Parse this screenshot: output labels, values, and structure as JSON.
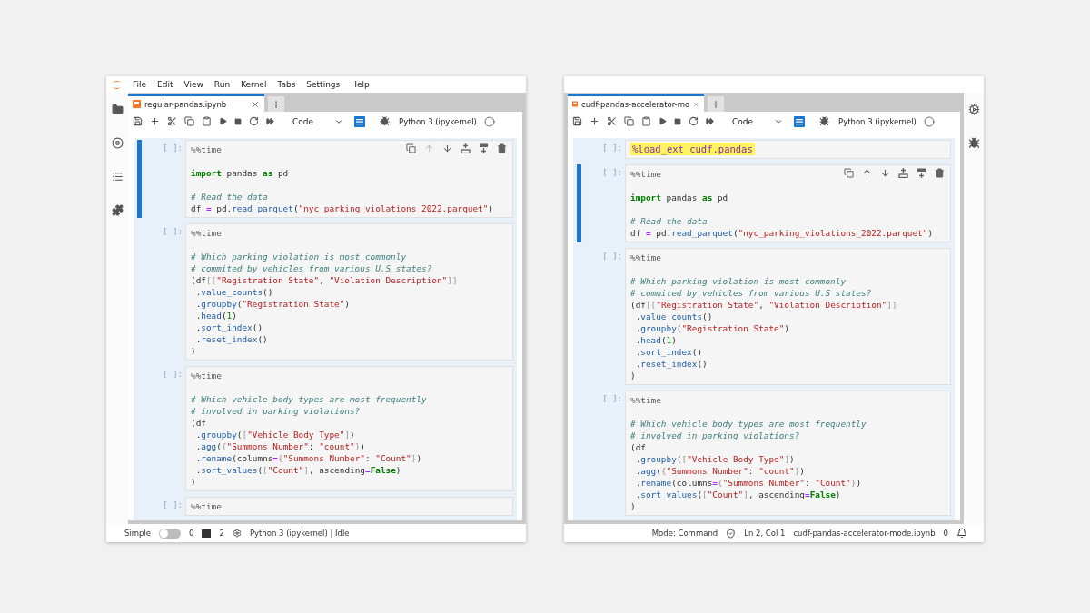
{
  "windows": [
    {
      "menu": [
        "File",
        "Edit",
        "View",
        "Run",
        "Kernel",
        "Tabs",
        "Settings",
        "Help"
      ],
      "left_sidebar": [
        {
          "kind": "folder"
        },
        {
          "kind": "stop"
        },
        {
          "kind": "list"
        },
        {
          "kind": "puzzle"
        }
      ],
      "tabs": [
        {
          "label": "regular-pandas.ipynb",
          "selected": true
        }
      ],
      "new_tab": "+",
      "toolbar": [
        {
          "kind": "save"
        },
        {
          "kind": "add"
        },
        {
          "kind": "cut"
        },
        {
          "kind": "copy"
        },
        {
          "kind": "paste"
        },
        {
          "kind": "run"
        },
        {
          "kind": "stop"
        },
        {
          "kind": "restart"
        },
        {
          "kind": "run-all"
        },
        {
          "kind": "dropdown",
          "text": "Code"
        },
        {
          "kind": "inspector"
        },
        {
          "kind": "bug"
        },
        {
          "kind": "kernel",
          "text": "Python 3 (ipykernel)"
        },
        {
          "kind": "status"
        }
      ],
      "cells": [
        {
          "prompt": "[ ]:",
          "selected": true,
          "toolbar": [
            {
              "kind": "duplicate",
              "disabled": false
            },
            {
              "kind": "up",
              "disabled": true
            },
            {
              "kind": "down",
              "disabled": false
            },
            {
              "kind": "insert-above",
              "disabled": false
            },
            {
              "kind": "insert-below",
              "disabled": false
            },
            {
              "kind": "delete",
              "disabled": false
            }
          ],
          "lines": [
            {
              "tokens": [
                {
                  "kind": "mg",
                  "text": "%%time"
                }
              ]
            },
            {
              "gap": true,
              "tokens": [
                {
                  "kind": "kw",
                  "text": "import"
                },
                {
                  "kind": "p",
                  "text": " pandas "
                },
                {
                  "kind": "kw",
                  "text": "as"
                },
                {
                  "kind": "p",
                  "text": " pd"
                }
              ]
            },
            {
              "gap": true,
              "tokens": [
                {
                  "kind": "cm",
                  "text": "# Read the data"
                }
              ]
            },
            {
              "tokens": [
                {
                  "kind": "p",
                  "text": "df "
                },
                {
                  "kind": "op",
                  "text": "="
                },
                {
                  "kind": "p",
                  "text": " pd."
                },
                {
                  "kind": "fn",
                  "text": "read_parquet"
                },
                {
                  "kind": "p",
                  "text": "("
                },
                {
                  "kind": "str",
                  "text": "\"nyc_parking_violations_2022.parquet\""
                },
                {
                  "kind": "p",
                  "text": ")"
                }
              ]
            }
          ]
        },
        {
          "prompt": "[ ]:",
          "selected": false,
          "lines": [
            {
              "tokens": [
                {
                  "kind": "mg",
                  "text": "%%time"
                }
              ]
            },
            {
              "gap": true,
              "tokens": [
                {
                  "kind": "cm",
                  "text": "# Which parking violation is most commonly"
                }
              ]
            },
            {
              "tokens": [
                {
                  "kind": "cm",
                  "text": "# commited by vehicles from various U.S states?"
                }
              ]
            },
            {
              "tokens": [
                {
                  "kind": "p",
                  "text": "(df"
                },
                {
                  "kind": "br",
                  "text": "[["
                },
                {
                  "kind": "str",
                  "text": "\"Registration State\""
                },
                {
                  "kind": "p",
                  "text": ", "
                },
                {
                  "kind": "str",
                  "text": "\"Violation Description\""
                },
                {
                  "kind": "br",
                  "text": "]]"
                }
              ]
            },
            {
              "tokens": [
                {
                  "kind": "p",
                  "text": " ."
                },
                {
                  "kind": "fn",
                  "text": "value_counts"
                },
                {
                  "kind": "p",
                  "text": "()"
                }
              ]
            },
            {
              "tokens": [
                {
                  "kind": "p",
                  "text": " ."
                },
                {
                  "kind": "fn",
                  "text": "groupby"
                },
                {
                  "kind": "p",
                  "text": "("
                },
                {
                  "kind": "str",
                  "text": "\"Registration State\""
                },
                {
                  "kind": "p",
                  "text": ")"
                }
              ]
            },
            {
              "tokens": [
                {
                  "kind": "p",
                  "text": " ."
                },
                {
                  "kind": "fn",
                  "text": "head"
                },
                {
                  "kind": "p",
                  "text": "("
                },
                {
                  "kind": "num",
                  "text": "1"
                },
                {
                  "kind": "p",
                  "text": ")"
                }
              ]
            },
            {
              "tokens": [
                {
                  "kind": "p",
                  "text": " ."
                },
                {
                  "kind": "fn",
                  "text": "sort_index"
                },
                {
                  "kind": "p",
                  "text": "()"
                }
              ]
            },
            {
              "tokens": [
                {
                  "kind": "p",
                  "text": " ."
                },
                {
                  "kind": "fn",
                  "text": "reset_index"
                },
                {
                  "kind": "p",
                  "text": "()"
                }
              ]
            },
            {
              "tokens": [
                {
                  "kind": "p",
                  "text": ")"
                }
              ]
            }
          ]
        },
        {
          "prompt": "[ ]:",
          "selected": false,
          "lines": [
            {
              "tokens": [
                {
                  "kind": "mg",
                  "text": "%%time"
                }
              ]
            },
            {
              "gap": true,
              "tokens": [
                {
                  "kind": "cm",
                  "text": "# Which vehicle body types are most frequently"
                }
              ]
            },
            {
              "tokens": [
                {
                  "kind": "cm",
                  "text": "# involved in parking violations?"
                }
              ]
            },
            {
              "tokens": [
                {
                  "kind": "p",
                  "text": "(df"
                }
              ]
            },
            {
              "tokens": [
                {
                  "kind": "p",
                  "text": " ."
                },
                {
                  "kind": "fn",
                  "text": "groupby"
                },
                {
                  "kind": "p",
                  "text": "("
                },
                {
                  "kind": "br",
                  "text": "["
                },
                {
                  "kind": "str",
                  "text": "\"Vehicle Body Type\""
                },
                {
                  "kind": "br",
                  "text": "]"
                },
                {
                  "kind": "p",
                  "text": ")"
                }
              ]
            },
            {
              "tokens": [
                {
                  "kind": "p",
                  "text": " ."
                },
                {
                  "kind": "fn",
                  "text": "agg"
                },
                {
                  "kind": "p",
                  "text": "("
                },
                {
                  "kind": "br",
                  "text": "{"
                },
                {
                  "kind": "str",
                  "text": "\"Summons Number\""
                },
                {
                  "kind": "p",
                  "text": ": "
                },
                {
                  "kind": "str",
                  "text": "\"count\""
                },
                {
                  "kind": "br",
                  "text": "}"
                },
                {
                  "kind": "p",
                  "text": ")"
                }
              ]
            },
            {
              "tokens": [
                {
                  "kind": "p",
                  "text": " ."
                },
                {
                  "kind": "fn",
                  "text": "rename"
                },
                {
                  "kind": "p",
                  "text": "(columns"
                },
                {
                  "kind": "op",
                  "text": "="
                },
                {
                  "kind": "br",
                  "text": "{"
                },
                {
                  "kind": "str",
                  "text": "\"Summons Number\""
                },
                {
                  "kind": "p",
                  "text": ": "
                },
                {
                  "kind": "str",
                  "text": "\"Count\""
                },
                {
                  "kind": "br",
                  "text": "}"
                },
                {
                  "kind": "p",
                  "text": ")"
                }
              ]
            },
            {
              "tokens": [
                {
                  "kind": "p",
                  "text": " ."
                },
                {
                  "kind": "fn",
                  "text": "sort_values"
                },
                {
                  "kind": "p",
                  "text": "("
                },
                {
                  "kind": "br",
                  "text": "["
                },
                {
                  "kind": "str",
                  "text": "\"Count\""
                },
                {
                  "kind": "br",
                  "text": "]"
                },
                {
                  "kind": "p",
                  "text": ", ascending"
                },
                {
                  "kind": "op",
                  "text": "="
                },
                {
                  "kind": "kw",
                  "text": "False"
                },
                {
                  "kind": "p",
                  "text": ")"
                }
              ]
            },
            {
              "tokens": [
                {
                  "kind": "p",
                  "text": ")"
                }
              ]
            }
          ]
        },
        {
          "prompt": "[ ]:",
          "selected": false,
          "lines": [
            {
              "tokens": [
                {
                  "kind": "mg",
                  "text": "%%time"
                }
              ]
            }
          ]
        }
      ],
      "status_bar": {
        "left": [
          {
            "kind": "toggle",
            "text": "Simple",
            "on": false
          },
          {
            "kind": "text",
            "text": "0"
          },
          {
            "kind": "terminal"
          },
          {
            "kind": "text",
            "text": "2"
          },
          {
            "kind": "kernel-gear"
          },
          {
            "kind": "text",
            "text": "Python 3 (ipykernel) | Idle"
          }
        ]
      }
    },
    {
      "right_sidebar": [
        {
          "kind": "gears"
        },
        {
          "kind": "bug"
        }
      ],
      "tabs": [
        {
          "label": "cudf-pandas-accelerator-mo",
          "selected": true
        }
      ],
      "new_tab": "+",
      "toolbar": [
        {
          "kind": "save"
        },
        {
          "kind": "add"
        },
        {
          "kind": "cut"
        },
        {
          "kind": "copy"
        },
        {
          "kind": "paste"
        },
        {
          "kind": "run"
        },
        {
          "kind": "stop"
        },
        {
          "kind": "restart"
        },
        {
          "kind": "run-all"
        },
        {
          "kind": "dropdown",
          "text": "Code"
        },
        {
          "kind": "inspector"
        },
        {
          "kind": "bug"
        },
        {
          "kind": "kernel",
          "text": "Python 3 (ipykernel)"
        },
        {
          "kind": "status"
        }
      ],
      "cells": [
        {
          "prompt": "[ ]:",
          "selected": false,
          "lines": [
            {
              "tokens": [
                {
                  "kind": "hl",
                  "text": "%load_ext cudf.pandas"
                }
              ]
            }
          ]
        },
        {
          "prompt": "[ ]:",
          "selected": true,
          "toolbar": [
            {
              "kind": "duplicate",
              "disabled": false
            },
            {
              "kind": "up",
              "disabled": false
            },
            {
              "kind": "down",
              "disabled": false
            },
            {
              "kind": "insert-above",
              "disabled": false
            },
            {
              "kind": "insert-below",
              "disabled": false
            },
            {
              "kind": "delete",
              "disabled": false
            }
          ],
          "lines": [
            {
              "tokens": [
                {
                  "kind": "mg",
                  "text": "%%time"
                }
              ]
            },
            {
              "gap": true,
              "tokens": [
                {
                  "kind": "kw",
                  "text": "import"
                },
                {
                  "kind": "p",
                  "text": " pandas "
                },
                {
                  "kind": "kw",
                  "text": "as"
                },
                {
                  "kind": "p",
                  "text": " pd"
                }
              ]
            },
            {
              "gap": true,
              "tokens": [
                {
                  "kind": "cm",
                  "text": "# Read the data"
                }
              ]
            },
            {
              "tokens": [
                {
                  "kind": "p",
                  "text": "df "
                },
                {
                  "kind": "op",
                  "text": "="
                },
                {
                  "kind": "p",
                  "text": " pd."
                },
                {
                  "kind": "fn",
                  "text": "read_parquet"
                },
                {
                  "kind": "p",
                  "text": "("
                },
                {
                  "kind": "str",
                  "text": "\"nyc_parking_violations_2022.parquet\""
                },
                {
                  "kind": "p",
                  "text": ")"
                }
              ]
            }
          ]
        },
        {
          "prompt": "[ ]:",
          "selected": false,
          "lines": [
            {
              "tokens": [
                {
                  "kind": "mg",
                  "text": "%%time"
                }
              ]
            },
            {
              "gap": true,
              "tokens": [
                {
                  "kind": "cm",
                  "text": "# Which parking violation is most commonly"
                }
              ]
            },
            {
              "tokens": [
                {
                  "kind": "cm",
                  "text": "# commited by vehicles from various U.S states?"
                }
              ]
            },
            {
              "tokens": [
                {
                  "kind": "p",
                  "text": "(df"
                },
                {
                  "kind": "br",
                  "text": "[["
                },
                {
                  "kind": "str",
                  "text": "\"Registration State\""
                },
                {
                  "kind": "p",
                  "text": ", "
                },
                {
                  "kind": "str",
                  "text": "\"Violation Description\""
                },
                {
                  "kind": "br",
                  "text": "]]"
                }
              ]
            },
            {
              "tokens": [
                {
                  "kind": "p",
                  "text": " ."
                },
                {
                  "kind": "fn",
                  "text": "value_counts"
                },
                {
                  "kind": "p",
                  "text": "()"
                }
              ]
            },
            {
              "tokens": [
                {
                  "kind": "p",
                  "text": " ."
                },
                {
                  "kind": "fn",
                  "text": "groupby"
                },
                {
                  "kind": "p",
                  "text": "("
                },
                {
                  "kind": "str",
                  "text": "\"Registration State\""
                },
                {
                  "kind": "p",
                  "text": ")"
                }
              ]
            },
            {
              "tokens": [
                {
                  "kind": "p",
                  "text": " ."
                },
                {
                  "kind": "fn",
                  "text": "head"
                },
                {
                  "kind": "p",
                  "text": "("
                },
                {
                  "kind": "num",
                  "text": "1"
                },
                {
                  "kind": "p",
                  "text": ")"
                }
              ]
            },
            {
              "tokens": [
                {
                  "kind": "p",
                  "text": " ."
                },
                {
                  "kind": "fn",
                  "text": "sort_index"
                },
                {
                  "kind": "p",
                  "text": "()"
                }
              ]
            },
            {
              "tokens": [
                {
                  "kind": "p",
                  "text": " ."
                },
                {
                  "kind": "fn",
                  "text": "reset_index"
                },
                {
                  "kind": "p",
                  "text": "()"
                }
              ]
            },
            {
              "tokens": [
                {
                  "kind": "p",
                  "text": ")"
                }
              ]
            }
          ]
        },
        {
          "prompt": "[ ]:",
          "selected": false,
          "lines": [
            {
              "tokens": [
                {
                  "kind": "mg",
                  "text": "%%time"
                }
              ]
            },
            {
              "gap": true,
              "tokens": [
                {
                  "kind": "cm",
                  "text": "# Which vehicle body types are most frequently"
                }
              ]
            },
            {
              "tokens": [
                {
                  "kind": "cm",
                  "text": "# involved in parking violations?"
                }
              ]
            },
            {
              "tokens": [
                {
                  "kind": "p",
                  "text": "(df"
                }
              ]
            },
            {
              "tokens": [
                {
                  "kind": "p",
                  "text": " ."
                },
                {
                  "kind": "fn",
                  "text": "groupby"
                },
                {
                  "kind": "p",
                  "text": "("
                },
                {
                  "kind": "br",
                  "text": "["
                },
                {
                  "kind": "str",
                  "text": "\"Vehicle Body Type\""
                },
                {
                  "kind": "br",
                  "text": "]"
                },
                {
                  "kind": "p",
                  "text": ")"
                }
              ]
            },
            {
              "tokens": [
                {
                  "kind": "p",
                  "text": " ."
                },
                {
                  "kind": "fn",
                  "text": "agg"
                },
                {
                  "kind": "p",
                  "text": "("
                },
                {
                  "kind": "br",
                  "text": "{"
                },
                {
                  "kind": "str",
                  "text": "\"Summons Number\""
                },
                {
                  "kind": "p",
                  "text": ": "
                },
                {
                  "kind": "str",
                  "text": "\"count\""
                },
                {
                  "kind": "br",
                  "text": "}"
                },
                {
                  "kind": "p",
                  "text": ")"
                }
              ]
            },
            {
              "tokens": [
                {
                  "kind": "p",
                  "text": " ."
                },
                {
                  "kind": "fn",
                  "text": "rename"
                },
                {
                  "kind": "p",
                  "text": "(columns"
                },
                {
                  "kind": "op",
                  "text": "="
                },
                {
                  "kind": "br",
                  "text": "{"
                },
                {
                  "kind": "str",
                  "text": "\"Summons Number\""
                },
                {
                  "kind": "p",
                  "text": ": "
                },
                {
                  "kind": "str",
                  "text": "\"Count\""
                },
                {
                  "kind": "br",
                  "text": "}"
                },
                {
                  "kind": "p",
                  "text": ")"
                }
              ]
            },
            {
              "tokens": [
                {
                  "kind": "p",
                  "text": " ."
                },
                {
                  "kind": "fn",
                  "text": "sort_values"
                },
                {
                  "kind": "p",
                  "text": "("
                },
                {
                  "kind": "br",
                  "text": "["
                },
                {
                  "kind": "str",
                  "text": "\"Count\""
                },
                {
                  "kind": "br",
                  "text": "]"
                },
                {
                  "kind": "p",
                  "text": ", ascending"
                },
                {
                  "kind": "op",
                  "text": "="
                },
                {
                  "kind": "kw",
                  "text": "False"
                },
                {
                  "kind": "p",
                  "text": ")"
                }
              ]
            },
            {
              "tokens": [
                {
                  "kind": "p",
                  "text": ")"
                }
              ]
            }
          ]
        }
      ],
      "status_bar": {
        "right": [
          {
            "kind": "text",
            "text": "Mode: Command"
          },
          {
            "kind": "shield"
          },
          {
            "kind": "text",
            "text": "Ln 2, Col 1"
          },
          {
            "kind": "text",
            "text": "cudf-pandas-accelerator-mode.ipynb"
          },
          {
            "kind": "text",
            "text": "0"
          },
          {
            "kind": "bell"
          }
        ]
      }
    }
  ]
}
